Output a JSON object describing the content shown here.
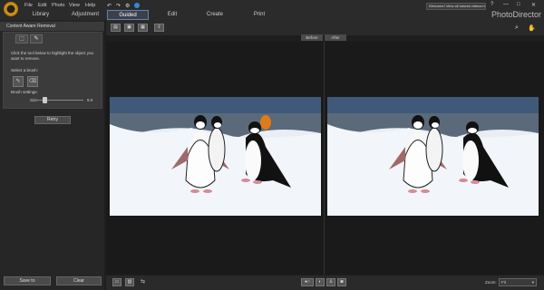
{
  "menu": [
    "File",
    "Edit",
    "Photo",
    "View",
    "Help"
  ],
  "welcome_text": "Welcome! View all tutorial videos here!",
  "brand": "PhotoDirector",
  "window_controls": [
    "?",
    "—",
    "□",
    "✕"
  ],
  "mode_tabs": [
    "Library",
    "Adjustment",
    "Guided",
    "Edit",
    "Create",
    "Print"
  ],
  "panel": {
    "title": "Content Aware Removal",
    "instructions": "Click the tool below to highlight the object you want to remove.",
    "select_brush": "Select a brush:",
    "brush_settings": "Brush settings:",
    "size_label": "Size",
    "size_value": "9.0",
    "retry": "Retry",
    "save": "Save to",
    "clear": "Clear"
  },
  "compare": {
    "before": "Before",
    "after": "After"
  },
  "zoom": {
    "label": "Zoom:",
    "value": "Fit"
  },
  "colors": {
    "accent": "#5a86b8",
    "logo": "#d9a21b"
  }
}
